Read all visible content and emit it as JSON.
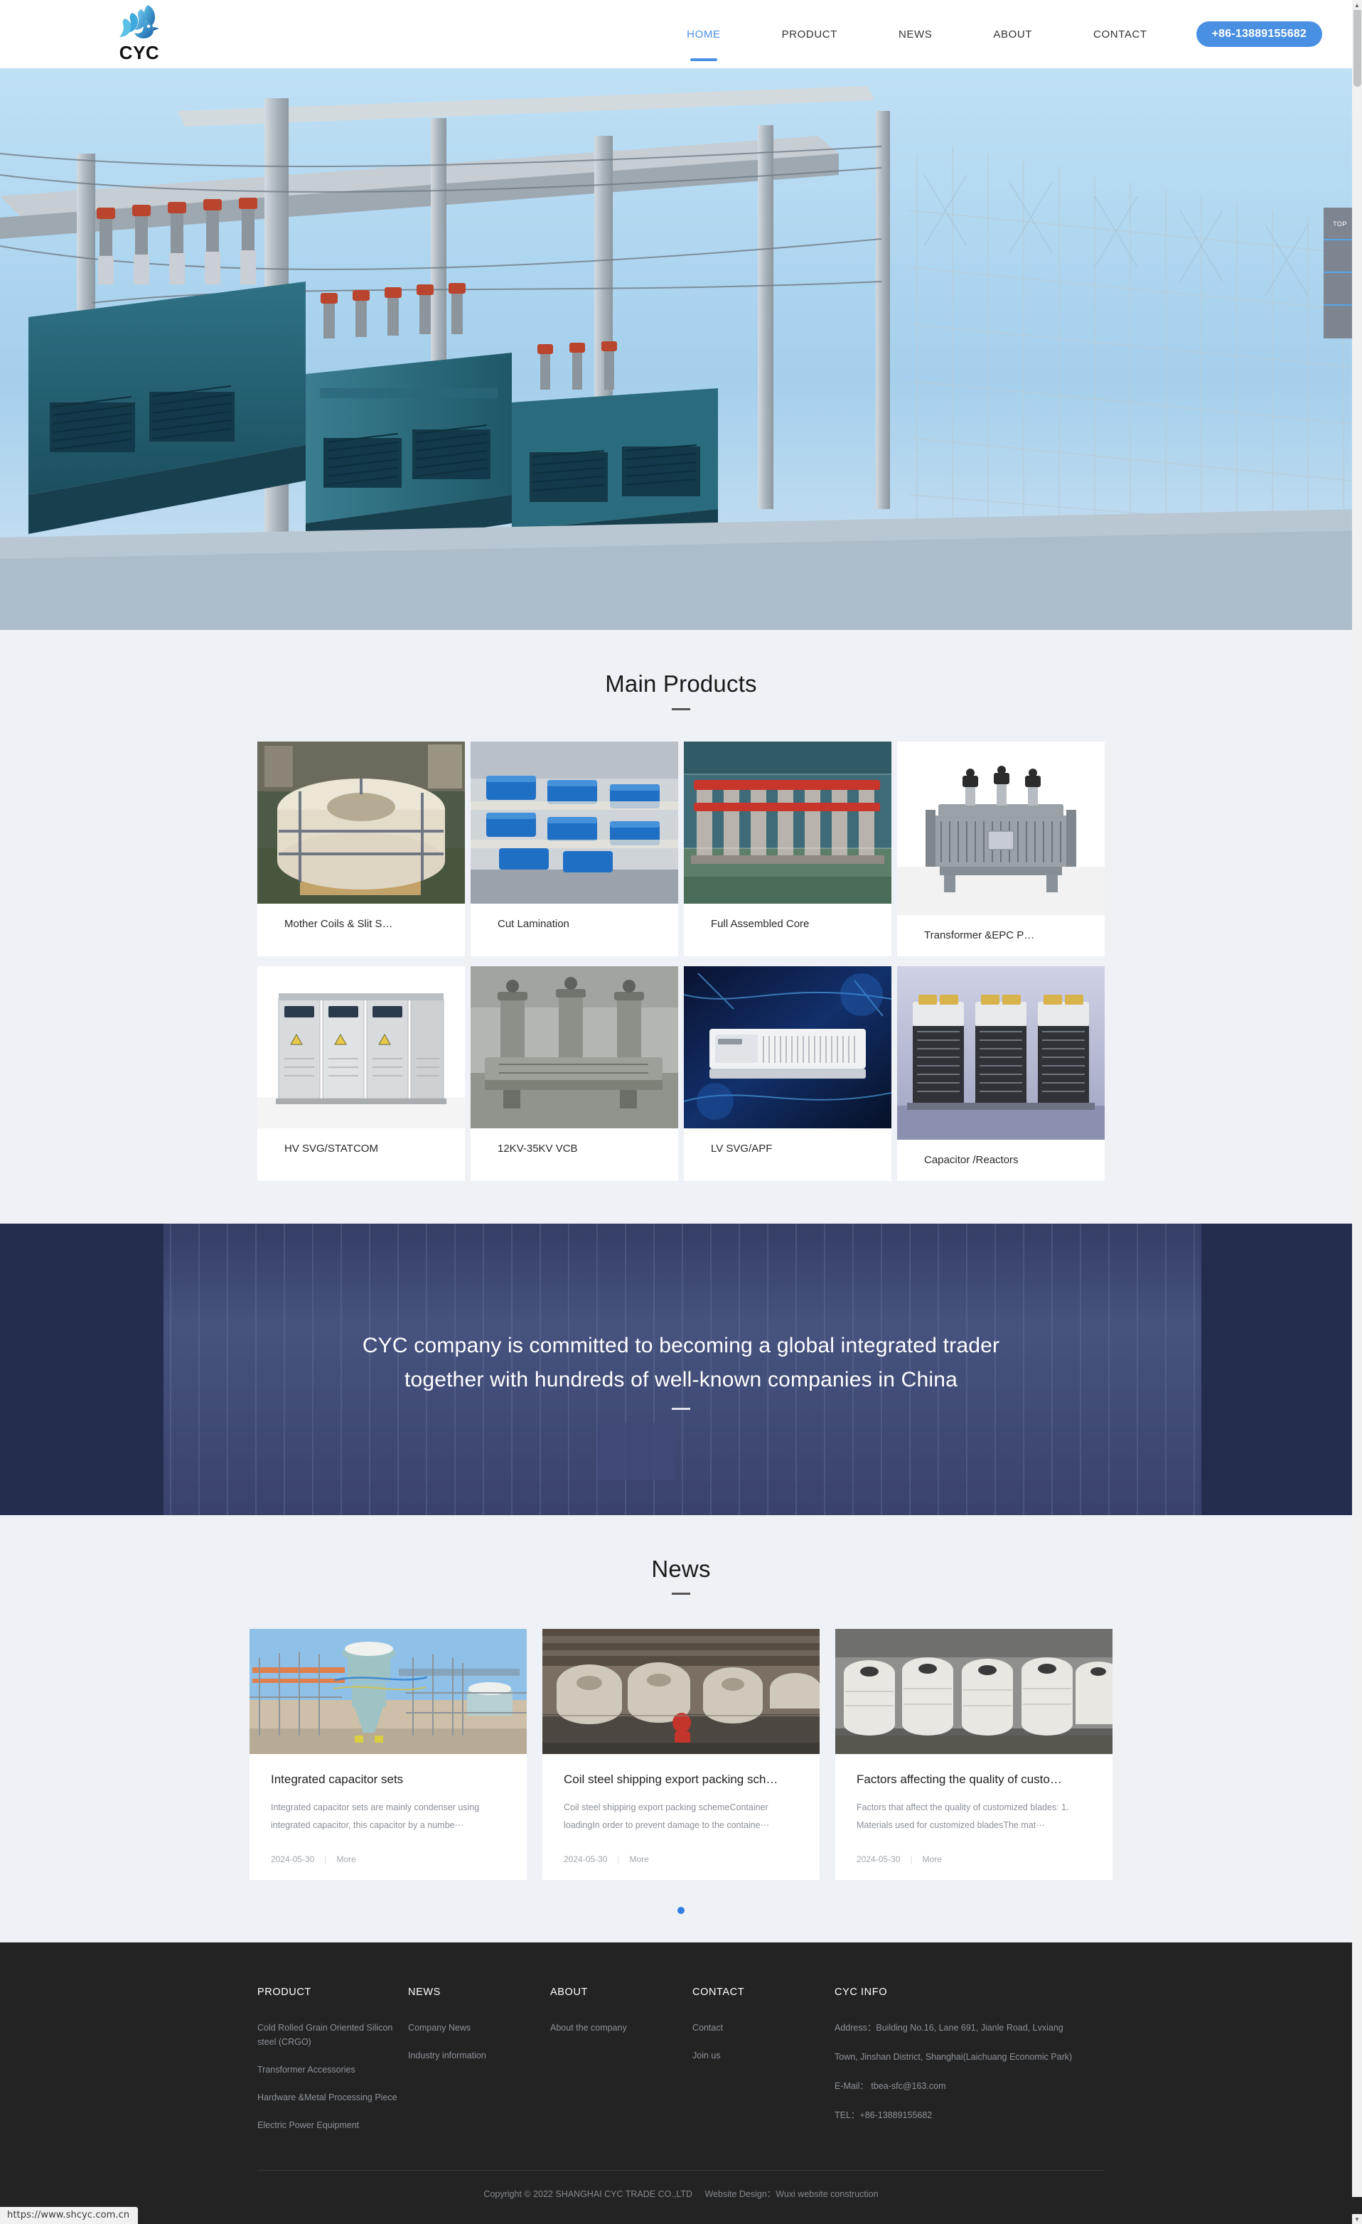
{
  "site": {
    "logo_text": "CYC",
    "logo_icon": "eagle-logo-icon",
    "status_url": "https://www.shcyc.com.cn"
  },
  "nav": {
    "items": [
      {
        "label": "HOME",
        "active": true
      },
      {
        "label": "PRODUCT",
        "active": false
      },
      {
        "label": "NEWS",
        "active": false
      },
      {
        "label": "ABOUT",
        "active": false
      },
      {
        "label": "CONTACT",
        "active": false
      }
    ],
    "phone_button": "+86-13889155682"
  },
  "side_tools": [
    {
      "icon": "arrow-up-icon",
      "label": "TOP"
    },
    {
      "icon": "qq-penguin-icon",
      "label": ""
    },
    {
      "icon": "phone-icon",
      "label": ""
    },
    {
      "icon": "qr-code-icon",
      "label": ""
    }
  ],
  "products": {
    "heading": "Main Products",
    "items": [
      {
        "name": "Mother Coils & Slit S…",
        "image": "steel-coil-photo",
        "raised": false
      },
      {
        "name": "Cut Lamination",
        "image": "cut-lamination-photo",
        "raised": false
      },
      {
        "name": "Full Assembled Core",
        "image": "assembled-core-photo",
        "raised": false
      },
      {
        "name": "Transformer &EPC P…",
        "image": "transformer-photo",
        "raised": true
      },
      {
        "name": "HV SVG/STATCOM",
        "image": "hv-svg-cabinet-photo",
        "raised": false
      },
      {
        "name": "12KV-35KV VCB",
        "image": "vcb-photo",
        "raised": false
      },
      {
        "name": "LV SVG/APF",
        "image": "lv-svg-photo",
        "raised": false
      },
      {
        "name": "Capacitor /Reactors",
        "image": "capacitor-reactor-photo",
        "raised": true
      }
    ]
  },
  "mid_banner": {
    "line1": "CYC company is committed to becoming a global integrated trader",
    "line2": "together with hundreds of well-known companies in China"
  },
  "news": {
    "heading": "News",
    "items": [
      {
        "title": "Integrated capacitor sets",
        "desc": "Integrated capacitor sets are mainly condenser using integrated capacitor, this capacitor by a numbe⋯",
        "date": "2024-05-30",
        "more": "More",
        "image": "substation-photo"
      },
      {
        "title": "Coil steel shipping export packing sch…",
        "desc": "Coil steel shipping export packing schemeContainer loadingIn order to prevent damage to the containe⋯",
        "date": "2024-05-30",
        "more": "More",
        "image": "warehouse-coils-photo"
      },
      {
        "title": "Factors affecting the quality of custo…",
        "desc": "Factors that affect the quality of customized blades: 1. Materials used for customized bladesThe mat⋯",
        "date": "2024-05-30",
        "more": "More",
        "image": "wrapped-coils-photo"
      }
    ],
    "pagination_dots": 1
  },
  "footer": {
    "columns": [
      {
        "title": "PRODUCT",
        "links": [
          "Cold Rolled Grain Oriented Silicon steel (CRGO)",
          "Transformer Accessories",
          "Hardware &Metal Processing Piece",
          "Electric Power Equipment"
        ]
      },
      {
        "title": "NEWS",
        "links": [
          "Company News",
          "Industry information"
        ]
      },
      {
        "title": "ABOUT",
        "links": [
          "About the company"
        ]
      },
      {
        "title": "CONTACT",
        "links": [
          "Contact",
          "Join us"
        ]
      }
    ],
    "info": {
      "title": "CYC INFO",
      "lines": [
        "Address：Building No.16, Lane 691, Jianle Road, Lvxiang",
        "Town, Jinshan District, Shanghai(Laichuang Economic Park)",
        "E-Mail：  tbea-sfc@163.com",
        "TEL：+86-13889155682"
      ]
    },
    "copyright": "Copyright © 2022 SHANGHAI CYC TRADE CO.,LTD",
    "web_design": "Website Design：Wuxi website construction"
  },
  "colors": {
    "accent": "#4a90e2",
    "page_bg": "#eef1f6",
    "footer_bg": "#232323",
    "dot": "#2f7fe0"
  }
}
